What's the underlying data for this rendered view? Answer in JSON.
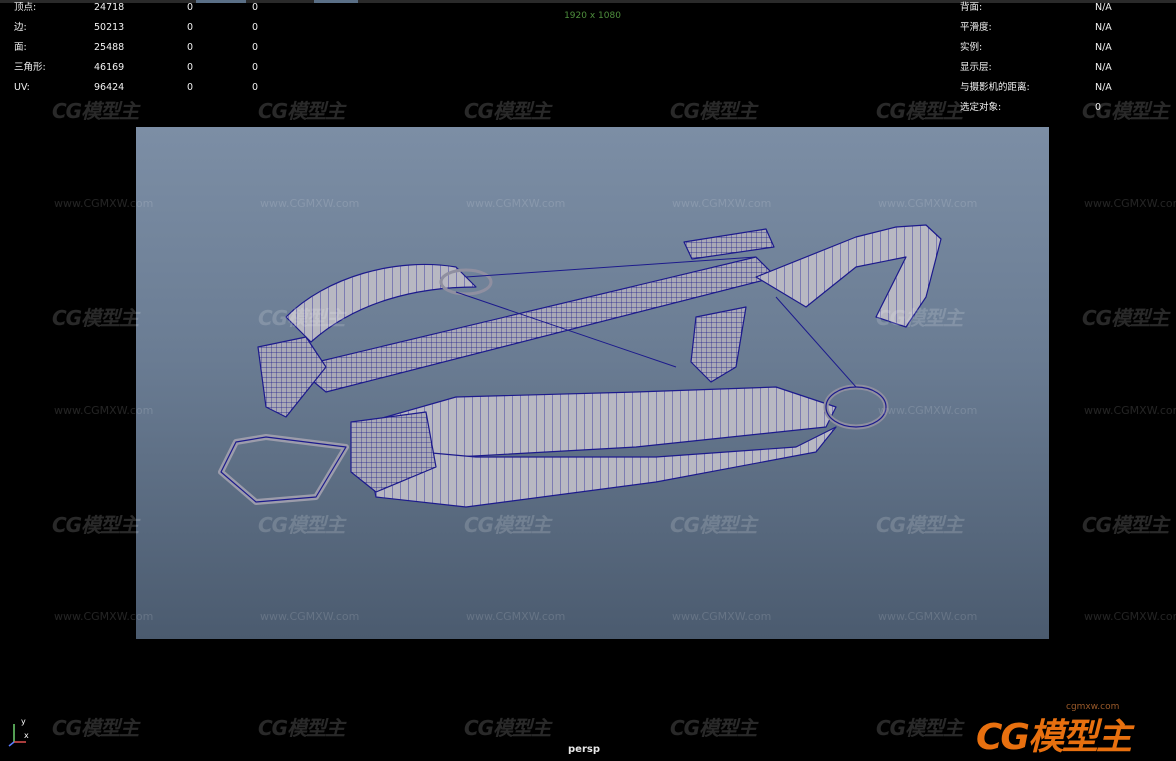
{
  "viewport": {
    "resolution_label": "1920 x 1080",
    "camera_label": "persp",
    "axis_labels": {
      "y": "y",
      "x": "x"
    }
  },
  "hud_left": [
    {
      "label": "顶点:",
      "value": "24718",
      "sel": "0",
      "sel2": "0"
    },
    {
      "label": "边:",
      "value": "50213",
      "sel": "0",
      "sel2": "0"
    },
    {
      "label": "面:",
      "value": "25488",
      "sel": "0",
      "sel2": "0"
    },
    {
      "label": "三角形:",
      "value": "46169",
      "sel": "0",
      "sel2": "0"
    },
    {
      "label": "UV:",
      "value": "96424",
      "sel": "0",
      "sel2": "0"
    }
  ],
  "hud_right": [
    {
      "label": "背面:",
      "value": "N/A"
    },
    {
      "label": "平滑度:",
      "value": "N/A"
    },
    {
      "label": "实例:",
      "value": "N/A"
    },
    {
      "label": "显示层:",
      "value": "N/A"
    },
    {
      "label": "与摄影机的距离:",
      "value": "N/A"
    },
    {
      "label": "选定对象:",
      "value": "0"
    }
  ],
  "watermark": {
    "logo": "CG模型主",
    "url": "www.CGMXW.com"
  },
  "brand": {
    "logo": "CG模型主",
    "url": "cgmxw.com"
  },
  "colors": {
    "background": "#000000",
    "gate_top": "#7c8ea5",
    "gate_bottom": "#4b5b6f",
    "wireframe": "#1c1a8c",
    "mesh_fill": "#b9b9c2",
    "resolution_label": "#4e8f3d",
    "brand_orange": "#e8700f"
  }
}
